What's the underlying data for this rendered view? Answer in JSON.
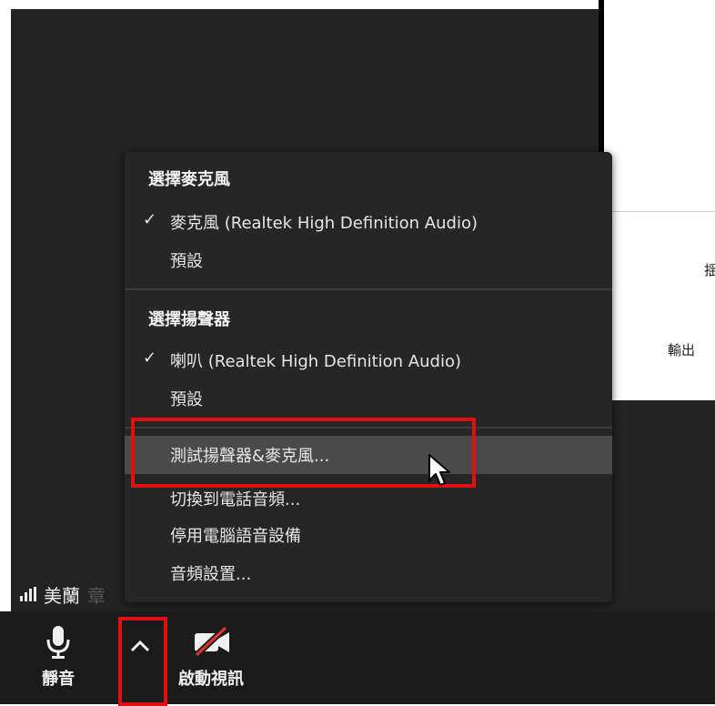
{
  "menu": {
    "mic_header": "選擇麥克風",
    "mic_selected": "麥克風 (Realtek High Definition Audio)",
    "mic_default": "預設",
    "speaker_header": "選擇揚聲器",
    "speaker_selected": "喇叭 (Realtek High Definition Audio)",
    "speaker_default": "預設",
    "test_audio": "測試揚聲器&麥克風...",
    "switch_phone": "切換到電話音頻...",
    "leave_computer_audio": "停用電腦語音設備",
    "audio_settings": "音頻設置...",
    "check_mark": "✓"
  },
  "participant": {
    "name": "美蘭",
    "name_partial": "章"
  },
  "right_panel": {
    "partial_text_1": "揺",
    "partial_text_2": "輸出"
  },
  "toolbar": {
    "mute_label": "靜音",
    "start_video_label": "啟動視訊"
  },
  "icons": {
    "mic": "microphone-icon",
    "caret": "chevron-up-icon",
    "video_off": "video-camera-off-icon",
    "signal": "signal-bars-icon",
    "cursor": "mouse-pointer-icon",
    "check": "checkmark-icon"
  },
  "colors": {
    "menu_bg": "#262626",
    "hover_bg": "#4a4a4a",
    "highlight_red": "#e01010",
    "toolbar_bg": "#1b1b1b",
    "video_off_slash": "#e0332d"
  }
}
